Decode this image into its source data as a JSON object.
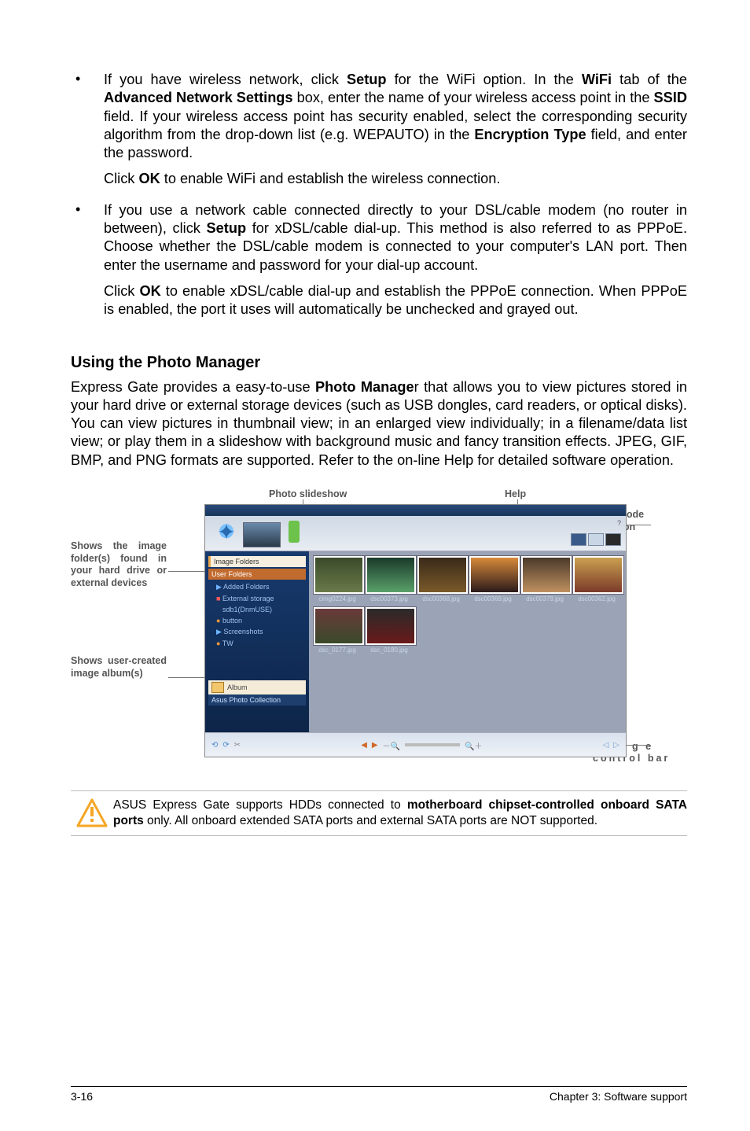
{
  "bullets": [
    {
      "p1_parts": [
        {
          "t": "If you have wireless network, click "
        },
        {
          "t": "Setup",
          "b": true
        },
        {
          "t": " for the WiFi option. In the "
        },
        {
          "t": "WiFi",
          "b": true
        },
        {
          "t": " tab of the "
        },
        {
          "t": "Advanced Network Settings",
          "b": true
        },
        {
          "t": " box, enter the name of your wireless access point in the "
        },
        {
          "t": "SSID",
          "b": true
        },
        {
          "t": " field. If your wireless access point has security enabled, select the corresponding security algorithm from the drop-down list (e.g. WEPAUTO) in the "
        },
        {
          "t": "Encryption Type",
          "b": true
        },
        {
          "t": " field, and enter the password."
        }
      ],
      "p2_parts": [
        {
          "t": "Click "
        },
        {
          "t": "OK",
          "b": true
        },
        {
          "t": " to enable WiFi and establish the wireless connection."
        }
      ]
    },
    {
      "p1_parts": [
        {
          "t": "If you use a network cable connected directly to your DSL/cable modem (no router in between), click "
        },
        {
          "t": "Setup",
          "b": true
        },
        {
          "t": " for xDSL/cable dial-up. This method is also referred to as PPPoE. Choose whether the DSL/cable modem is connected to your computer's LAN port. Then enter the username and password for your dial-up account."
        }
      ],
      "p2_parts": [
        {
          "t": "Click "
        },
        {
          "t": "OK",
          "b": true
        },
        {
          "t": " to enable xDSL/cable dial-up and establish the PPPoE connection. When PPPoE is enabled, the port it uses will automatically be unchecked and grayed out."
        }
      ]
    }
  ],
  "section_heading": "Using the Photo Manager",
  "section_para_parts": [
    {
      "t": "Express Gate  provides a easy-to-use "
    },
    {
      "t": "Photo Manage",
      "b": true
    },
    {
      "t": "r that allows you to view pictures stored in your hard drive or external storage devices (such as USB dongles, card readers, or optical disks). You can view pictures in thumbnail view; in an enlarged view individually; in a filename/data list view; or play them in a slideshow with background music and fancy transition effects. JPEG, GIF, BMP, and PNG formats are supported. Refer to the on-line Help for detailed software operation."
    }
  ],
  "diagram": {
    "top_label_1": "Photo slideshow",
    "top_label_2": "Help",
    "right_label_1": "View mode selection",
    "right_label_2": "I m a g e control bar",
    "left_label_1": "Shows the image folder(s) found in your hard drive or external devices",
    "left_label_2": "Shows user-created image album(s)",
    "sidebar": {
      "image_folders": "Image Folders",
      "user_folders": "User Folders",
      "added_folders": "Added Folders",
      "ext_storage": "External storage",
      "sdb1": "sdb1(DnmUSE)",
      "button": "button",
      "screenshots": "Screenshots",
      "tw": "TW",
      "album": "Album",
      "photo_collection": "Asus Photo Collection"
    },
    "thumbs": [
      "cimg0224.jpg",
      "dsc00373.jpg",
      "dsc00368.jpg",
      "dsc00369.jpg",
      "dsc00379.jpg",
      "dsc00362.jpg",
      "dsc_0177.jpg",
      "dsc_0180.jpg"
    ]
  },
  "note_parts": [
    {
      "t": "ASUS Express Gate supports HDDs connected to "
    },
    {
      "t": "motherboard chipset-controlled onboard SATA ports",
      "b": true
    },
    {
      "t": " only. All onboard extended SATA ports and external SATA ports are NOT supported."
    }
  ],
  "footer": {
    "left": "3-16",
    "right": "Chapter 3: Software support"
  }
}
